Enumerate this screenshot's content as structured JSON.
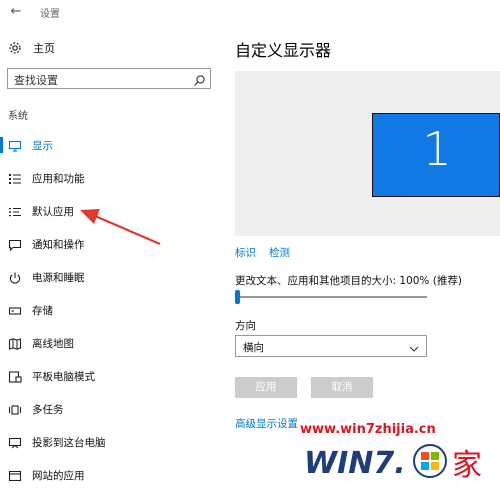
{
  "window": {
    "title": "设置",
    "back_icon": "back-arrow-icon"
  },
  "sidebar": {
    "home_label": "主页",
    "search_placeholder": "查找设置",
    "section_label": "系统",
    "items": [
      {
        "label": "显示",
        "icon": "monitor-icon",
        "active": true
      },
      {
        "label": "应用和功能",
        "icon": "list-icon"
      },
      {
        "label": "默认应用",
        "icon": "default-apps-icon"
      },
      {
        "label": "通知和操作",
        "icon": "message-icon"
      },
      {
        "label": "电源和睡眠",
        "icon": "power-icon"
      },
      {
        "label": "存储",
        "icon": "storage-icon"
      },
      {
        "label": "离线地图",
        "icon": "map-icon"
      },
      {
        "label": "平板电脑模式",
        "icon": "tablet-icon"
      },
      {
        "label": "多任务",
        "icon": "multitask-icon"
      },
      {
        "label": "投影到这台电脑",
        "icon": "project-icon"
      },
      {
        "label": "网站的应用",
        "icon": "web-apps-icon"
      }
    ]
  },
  "main": {
    "title": "自定义显示器",
    "monitor_number": "1",
    "identify_label": "标识",
    "detect_label": "检测",
    "scale_label": "更改文本、应用和其他项目的大小: 100% (推荐)",
    "scale_value_percent": 100,
    "slider_fraction": 0,
    "orientation_label": "方向",
    "orientation_value": "横向",
    "apply_label": "应用",
    "cancel_label": "取消",
    "advanced_link": "高级显示设置"
  },
  "watermark": {
    "url": "www.win7zhijia.cn",
    "logo_text": "WIN7.",
    "logo_char": "家"
  },
  "colors": {
    "accent": "#0078d7",
    "monitor_blue": "#1079e3",
    "annotation_red": "#e03a2e",
    "watermark_red": "#e0141e"
  }
}
